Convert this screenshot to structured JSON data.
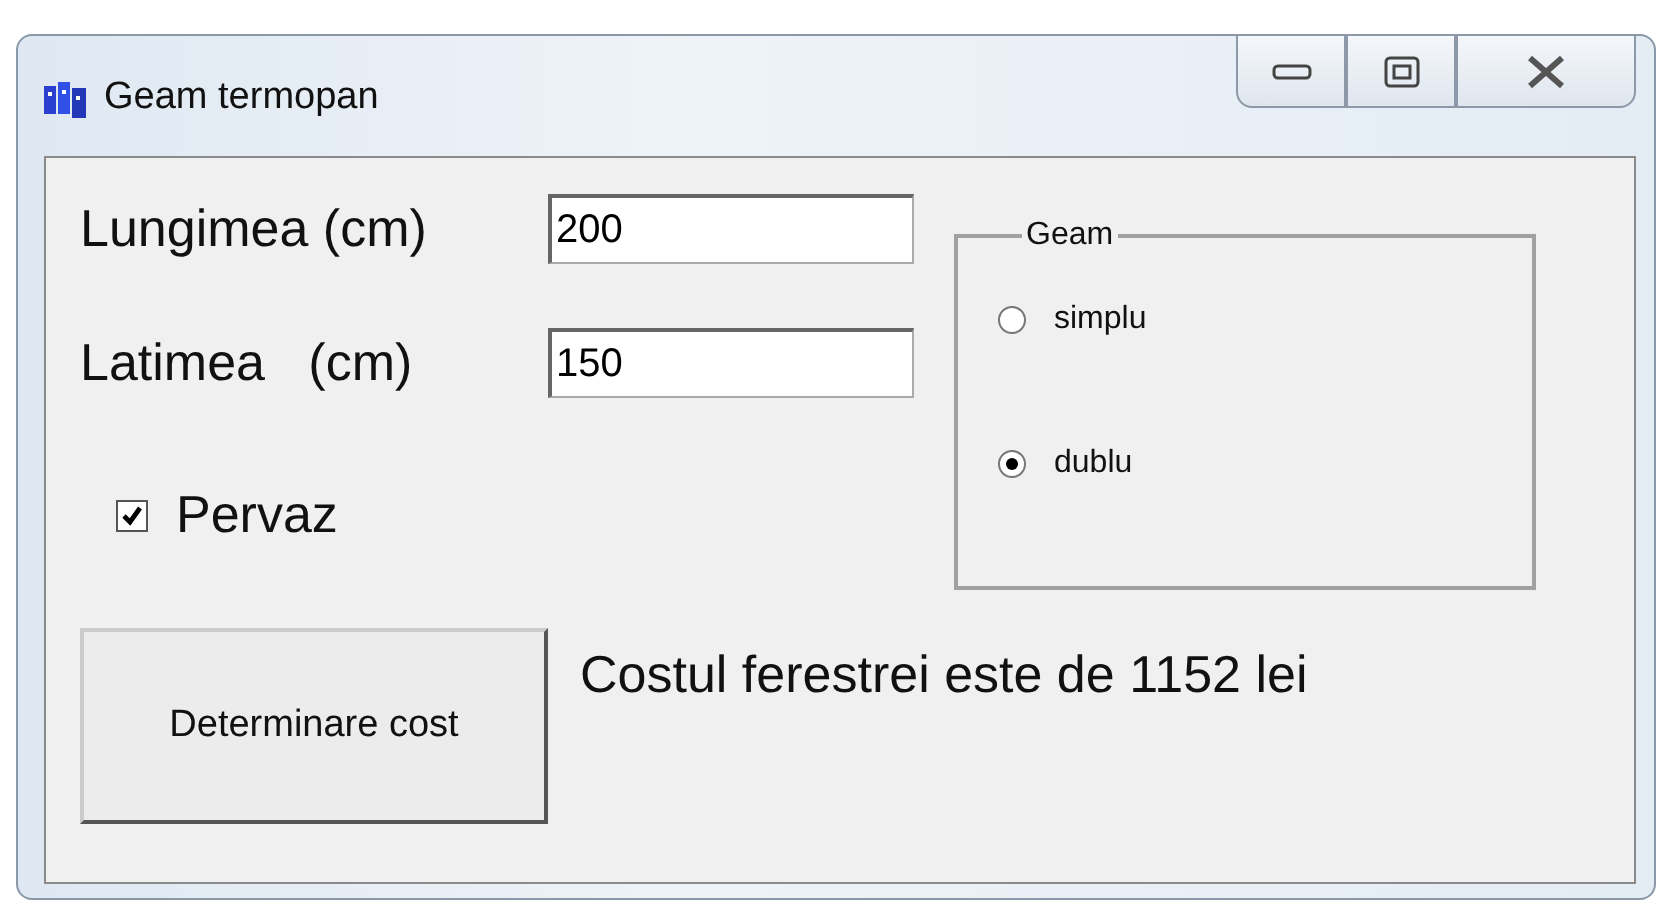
{
  "window": {
    "title": "Geam termopan"
  },
  "fields": [
    {
      "label": "Lungimea (cm)",
      "value": "200"
    },
    {
      "label": "Latimea   (cm)",
      "value": "150"
    }
  ],
  "checkbox": {
    "label": "Pervaz",
    "checked": true
  },
  "group": {
    "title": "Geam",
    "options": [
      {
        "label": "simplu",
        "selected": false
      },
      {
        "label": "dublu",
        "selected": true
      }
    ]
  },
  "button": {
    "label": "Determinare cost"
  },
  "result": "Costul ferestrei este de 1152 lei"
}
